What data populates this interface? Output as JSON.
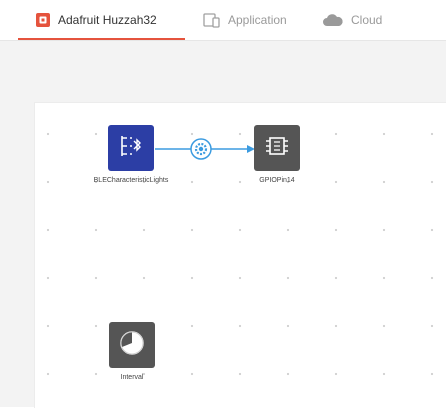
{
  "tabs": [
    {
      "label": "Adafruit Huzzah32",
      "icon": "board-icon",
      "active": true
    },
    {
      "label": "Application",
      "icon": "devices-icon",
      "active": false
    },
    {
      "label": "Cloud",
      "icon": "cloud-icon",
      "active": false
    }
  ],
  "canvas": {
    "nodes": [
      {
        "id": "ble",
        "label": "BLECharacteristicLights",
        "icon": "bluetooth-characteristic-icon",
        "color": "#2c3ea5"
      },
      {
        "id": "gpio",
        "label": "GPIOPin14",
        "icon": "gpio-pin-icon",
        "color": "#555555"
      },
      {
        "id": "interval",
        "label": "Interval",
        "icon": "interval-timer-icon",
        "color": "#555555"
      }
    ],
    "connections": [
      {
        "from": "BLECharacteristicLights",
        "to": "GPIOPin14",
        "icon": "gear-icon"
      }
    ]
  },
  "colors": {
    "accent": "#e5533d",
    "link": "#3b9be0",
    "ble_node": "#2c3ea5",
    "gray_node": "#555555"
  }
}
